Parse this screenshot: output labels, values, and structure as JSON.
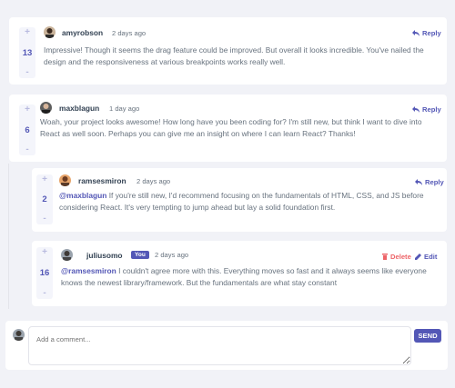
{
  "comments": [
    {
      "username": "amyrobson",
      "date": "2 days ago",
      "score": "13",
      "reply_label": "Reply",
      "text": "Impressive! Though it seems the drag feature could be improved. But overall it looks incredible. You've nailed the design and the responsiveness at various breakpoints works really well."
    },
    {
      "username": "maxblagun",
      "date": "1 day ago",
      "score": "6",
      "reply_label": "Reply",
      "text": "Woah, your project looks awesome! How long have you been coding for? I'm still new, but think I want to dive into React as well soon. Perhaps you can give me an insight on where I can learn React? Thanks!"
    }
  ],
  "replies": [
    {
      "username": "ramsesmiron",
      "date": "2 days ago",
      "score": "2",
      "reply_label": "Reply",
      "mention": "@maxblagun",
      "text": " If you're still new, I'd recommend focusing on the fundamentals of HTML, CSS, and JS before considering React. It's very tempting to jump ahead but lay a solid foundation first."
    },
    {
      "username": "juliusomo",
      "you_badge": "You",
      "date": "2 days ago",
      "score": "16",
      "delete_label": "Delete",
      "edit_label": "Edit",
      "mention": "@ramsesmiron",
      "text": " I couldn't agree more with this. Everything moves so fast and it always seems like everyone knows the newest library/framework. But the fundamentals are what stay constant"
    }
  ],
  "composer": {
    "placeholder": "Add a comment...",
    "send_label": "SEND"
  },
  "colors": {
    "accent": "#5357b6",
    "danger": "#ed6468",
    "background": "#f1f2f7"
  },
  "icons": {
    "upvote": "plus-icon",
    "downvote": "minus-icon",
    "reply": "reply-icon",
    "delete": "trash-icon",
    "edit": "pencil-icon"
  }
}
